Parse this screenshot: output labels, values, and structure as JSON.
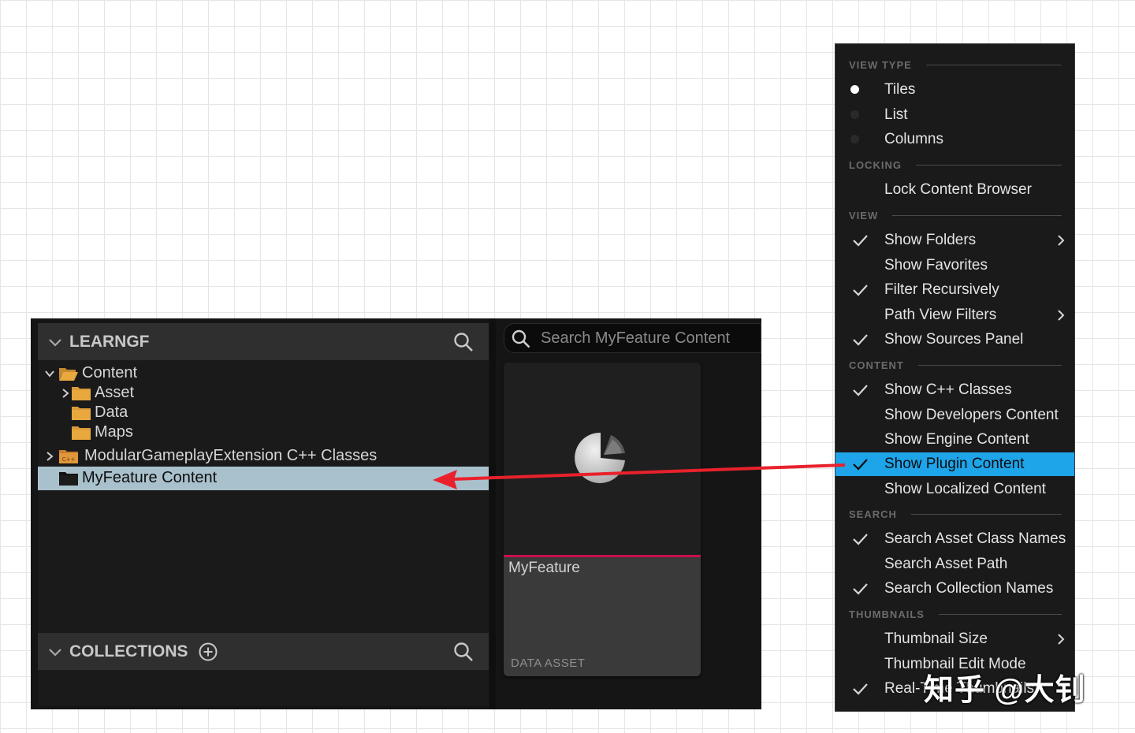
{
  "sources_panel": {
    "header_title": "LEARNGF",
    "tree": [
      {
        "label": "Content",
        "level": 0,
        "expanded": true,
        "icon": "folder-open-icon"
      },
      {
        "label": "Asset",
        "level": 1,
        "expanded": false,
        "icon": "folder-icon"
      },
      {
        "label": "Data",
        "level": 1,
        "icon": "folder-icon"
      },
      {
        "label": "Maps",
        "level": 1,
        "icon": "folder-icon"
      },
      {
        "label": "ModularGameplayExtension C++ Classes",
        "level": 0,
        "expanded": false,
        "icon": "cpp-folder-icon"
      },
      {
        "label": "MyFeature Content",
        "level": 0,
        "selected": true,
        "icon": "folder-dark-icon"
      }
    ],
    "collections_title": "COLLECTIONS"
  },
  "search": {
    "placeholder": "Search MyFeature Content"
  },
  "asset_tile": {
    "name": "MyFeature",
    "type": "DATA ASSET"
  },
  "menu": {
    "sections": [
      {
        "title": "VIEW TYPE",
        "items": [
          {
            "label": "Tiles",
            "radio": true,
            "selected": true
          },
          {
            "label": "List",
            "radio": true,
            "selected": false
          },
          {
            "label": "Columns",
            "radio": true,
            "selected": false
          }
        ]
      },
      {
        "title": "LOCKING",
        "items": [
          {
            "label": "Lock Content Browser",
            "checked": false
          }
        ]
      },
      {
        "title": "VIEW",
        "items": [
          {
            "label": "Show Folders",
            "checked": true,
            "submenu": true
          },
          {
            "label": "Show Favorites",
            "checked": false
          },
          {
            "label": "Filter Recursively",
            "checked": true
          },
          {
            "label": "Path View Filters",
            "checked": false,
            "submenu": true
          },
          {
            "label": "Show Sources Panel",
            "checked": true
          }
        ]
      },
      {
        "title": "CONTENT",
        "items": [
          {
            "label": "Show C++ Classes",
            "checked": true
          },
          {
            "label": "Show Developers Content",
            "checked": false
          },
          {
            "label": "Show Engine Content",
            "checked": false
          },
          {
            "label": "Show Plugin Content",
            "checked": true,
            "highlighted": true
          },
          {
            "label": "Show Localized Content",
            "checked": false
          }
        ]
      },
      {
        "title": "SEARCH",
        "items": [
          {
            "label": "Search Asset Class Names",
            "checked": true
          },
          {
            "label": "Search Asset Path",
            "checked": false
          },
          {
            "label": "Search Collection Names",
            "checked": true
          }
        ]
      },
      {
        "title": "THUMBNAILS",
        "items": [
          {
            "label": "Thumbnail Size",
            "checked": false,
            "submenu": true
          },
          {
            "label": "Thumbnail Edit Mode",
            "checked": false
          },
          {
            "label": "Real-Time Thumbnails",
            "checked": true
          }
        ]
      }
    ]
  },
  "watermark": "知乎 @大钊",
  "colors": {
    "highlight": "#1ea4e9",
    "selection": "#a9c1cc",
    "arrow": "#e8212b",
    "accent": "#c8104b"
  }
}
